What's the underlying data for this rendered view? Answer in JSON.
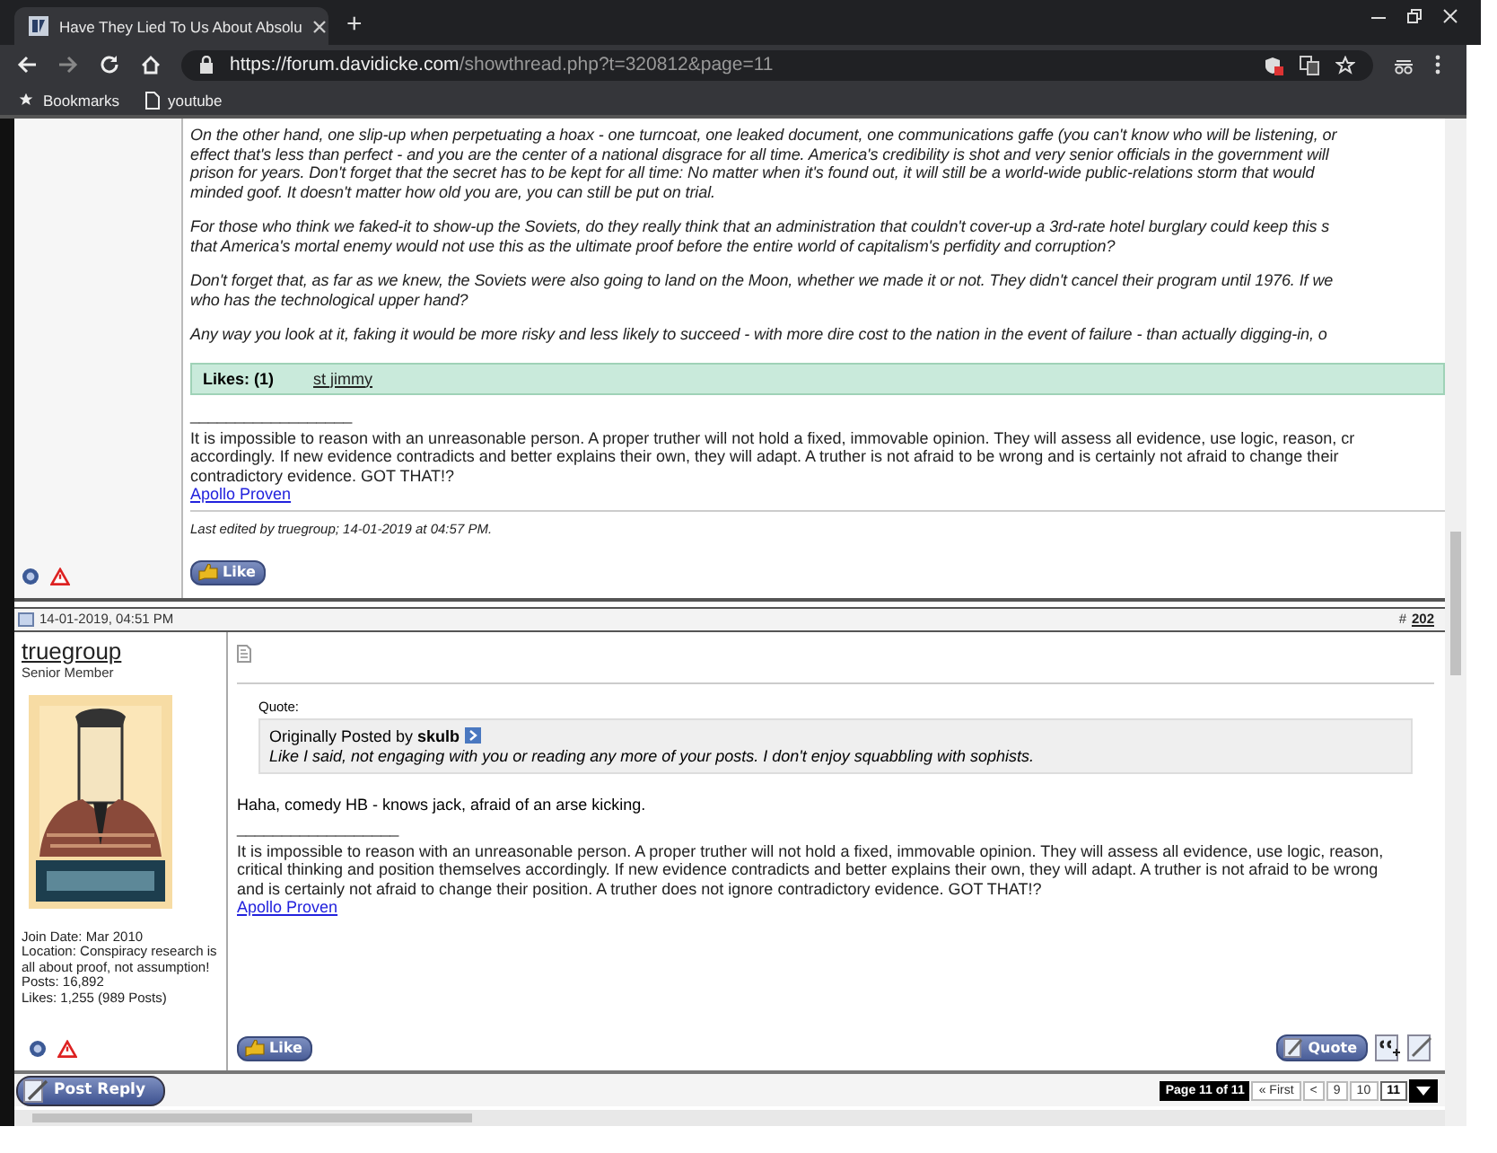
{
  "browser": {
    "tab_title": "Have They Lied To Us About Absolu",
    "new_tab": "+",
    "url_host": "https://forum.davidicke.com",
    "url_path": "/showthread.php?t=320812&page=11",
    "bookmarks": [
      {
        "label": "Bookmarks",
        "kind": "star"
      },
      {
        "label": "youtube",
        "kind": "page"
      }
    ]
  },
  "posts": [
    {
      "paragraphs": [
        [
          "On the other hand, one slip-up when perpetuating a hoax - one turncoat, one leaked document, one communications gaffe (you can't know who will be listening, or",
          "effect that's less than perfect - and you are the center of a national disgrace for all time. America's credibility is shot and very senior officials in the government will",
          "prison for years. Don't forget that the secret has to be kept for all time: No matter when it's found out, it will still be a world-wide public-relations storm that would",
          "minded goof. It doesn't matter how old you are, you can still be put on trial."
        ],
        [
          "For those who think we faked-it to show-up the Soviets, do they really think that an administration that couldn't cover-up a 3rd-rate hotel burglary could keep this s",
          "that America's mortal enemy would not use this as the ultimate proof before the entire world of capitalism's perfidity and corruption?"
        ],
        [
          "Don't forget that, as far as we knew, the Soviets were also going to land on the Moon, whether we made it or not. They didn't cancel their program until 1976. If we",
          "who has the technological upper hand?"
        ],
        [
          "Any way you look at it, faking it would be more risky and less likely to succeed - with more dire cost to the nation in the event of failure - than actually digging-in, o"
        ]
      ],
      "likes": {
        "label": "Likes: (1)",
        "users": [
          "st jimmy"
        ]
      },
      "sig_rule": "__________________",
      "signature": [
        "It is impossible to reason with an unreasonable person. A proper truther will not hold a fixed, immovable opinion. They will assess all evidence, use logic, reason, cr",
        "accordingly. If new evidence contradicts and better explains their own, they will adapt. A truther is not afraid to be wrong and is certainly not afraid to change their",
        "contradictory evidence. GOT THAT!?"
      ],
      "signature_link": "Apollo Proven",
      "edited": "Last edited by truegroup; 14-01-2019 at 04:57 PM.",
      "like_button": "Like"
    },
    {
      "date": "14-01-2019, 04:51 PM",
      "number_prefix": "#",
      "number": "202",
      "user": {
        "name": "truegroup",
        "title": "Senior Member",
        "avatar": {
          "kind": "picture"
        },
        "details": [
          "Join Date: Mar 2010",
          "Location: Conspiracy research is all about proof, not assumption!",
          "Posts: 16,892",
          "Likes: 1,255 (989 Posts)"
        ]
      },
      "quote": {
        "label": "Quote:",
        "source": "Originally Posted by **skulb**",
        "text": "Like I said, not engaging with you or reading any more of your posts. I don't enjoy squabbling with sophists."
      },
      "body": "Haha, comedy HB - knows jack, afraid of an arse kicking.",
      "sig_rule": "__________________",
      "signature": "It is impossible to reason with an unreasonable person. A proper truther will not hold a fixed, immovable opinion. They will assess all evidence, use logic, reason, critical thinking and position themselves accordingly. If new evidence contradicts and better explains their own, they will adapt. A truther is not afraid to be wrong and is certainly not afraid to change their position. A truther does not ignore contradictory evidence. GOT THAT!?",
      "signature_link": "Apollo Proven",
      "like_button": "Like",
      "quote_button": "Quote"
    }
  ],
  "footer": {
    "reply_button": "Post Reply",
    "page_label": "Page 11 of 11",
    "pages": [
      {
        "label": "« First",
        "selected": false
      },
      {
        "label": "<",
        "selected": false
      },
      {
        "label": "9",
        "selected": false
      },
      {
        "label": "10",
        "selected": false
      },
      {
        "label": "11",
        "selected": true
      }
    ]
  }
}
